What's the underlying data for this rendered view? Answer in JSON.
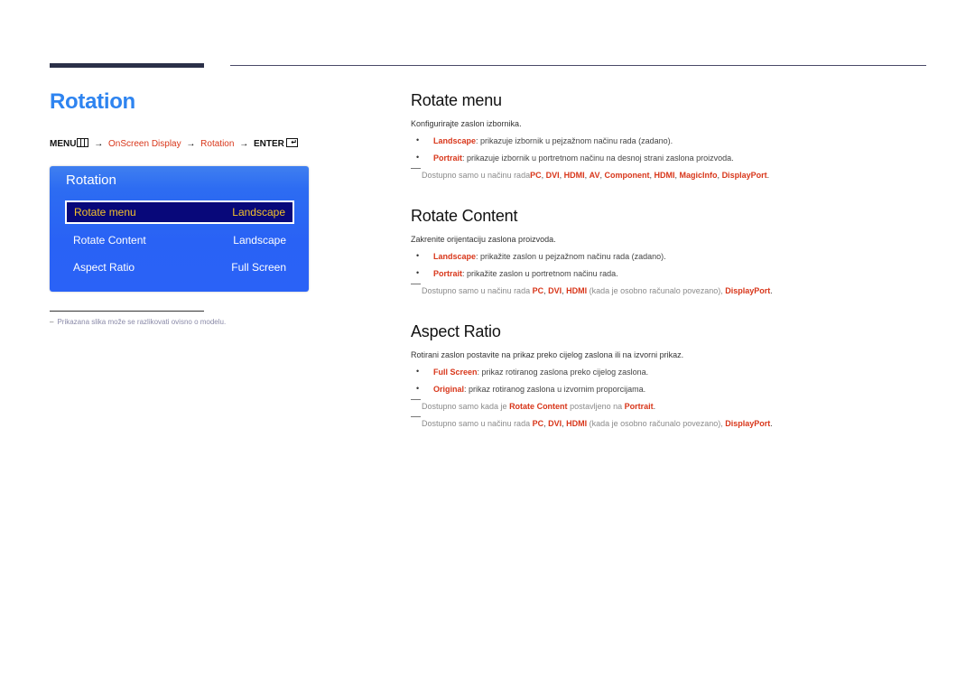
{
  "page": {
    "title": "Rotation",
    "menu_path": {
      "menu_label": "MENU",
      "menu_icon": "menu-grid-icon",
      "arrow": "→",
      "step1": "OnScreen Display",
      "step2": "Rotation",
      "enter_label": "ENTER",
      "enter_icon": "enter-return-icon",
      "enter_glyph": "↵"
    }
  },
  "osd": {
    "title": "Rotation",
    "rows": [
      {
        "label": "Rotate menu",
        "value": "Landscape",
        "selected": true
      },
      {
        "label": "Rotate Content",
        "value": "Landscape",
        "selected": false
      },
      {
        "label": "Aspect Ratio",
        "value": "Full Screen",
        "selected": false
      }
    ]
  },
  "footnote": {
    "dash": "–",
    "text": "Prikazana slika može se razlikovati ovisno o modelu."
  },
  "sections": [
    {
      "heading": "Rotate menu",
      "lead": "Konfigurirajte zaslon izbornika.",
      "bullets": [
        {
          "term": "Landscape",
          "text": ": prikazuje izbornik u pejzažnom načinu rada (zadano)."
        },
        {
          "term": "Portrait",
          "text": ": prikazuje izbornik u portretnom načinu na desnoj strani zaslona proizvoda."
        }
      ],
      "notes": [
        {
          "prefix": "Dostupno samo u načinu rada",
          "items": [
            "PC",
            "DVI",
            "HDMI",
            "AV",
            "Component",
            "HDMI",
            "MagicInfo",
            "DisplayPort"
          ],
          "suffix": "."
        }
      ]
    },
    {
      "heading": "Rotate Content",
      "lead": "Zakrenite orijentaciju zaslona proizvoda.",
      "bullets": [
        {
          "term": "Landscape",
          "text": ": prikažite zaslon u pejzažnom načinu rada (zadano)."
        },
        {
          "term": "Portrait",
          "text": ": prikažite zaslon u portretnom načinu rada."
        }
      ],
      "notes": [
        {
          "prefix": "Dostupno samo u načinu rada ",
          "items": [
            "PC",
            "DVI",
            "HDMI"
          ],
          "mid": " (kada je osobno računalo povezano), ",
          "last": "DisplayPort",
          "suffix": "."
        }
      ]
    },
    {
      "heading": "Aspect Ratio",
      "lead": "Rotirani zaslon postavite na prikaz preko cijelog zaslona ili na izvorni prikaz.",
      "bullets": [
        {
          "term": "Full Screen",
          "text": ": prikaz rotiranog zaslona preko cijelog zaslona."
        },
        {
          "term": "Original",
          "text": ": prikaz rotiranog zaslona u izvornim proporcijama."
        }
      ],
      "notes": [
        {
          "prefix": "Dostupno samo kada je ",
          "term1": "Rotate Content",
          "mid": " postavljeno na ",
          "term2": "Portrait",
          "suffix": "."
        },
        {
          "prefix": "Dostupno samo u načinu rada ",
          "items": [
            "PC",
            "DVI",
            "HDMI"
          ],
          "mid": " (kada je osobno računalo povezano), ",
          "last": "DisplayPort",
          "suffix": "."
        }
      ]
    }
  ],
  "colors": {
    "title_blue": "#2e84f0",
    "accent_red": "#d8361a",
    "osd_blue": "#2962f5",
    "osd_selected_bg": "#08087a",
    "osd_selected_text": "#f2c02c"
  }
}
